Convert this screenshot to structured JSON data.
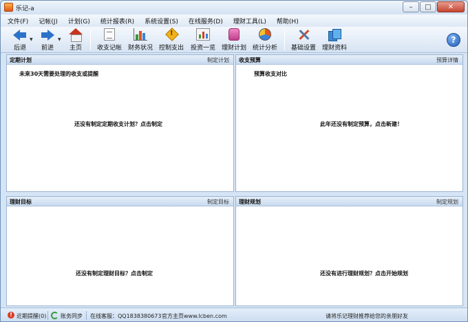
{
  "window": {
    "title": "乐记-a"
  },
  "menu": [
    "文件(F)",
    "记帐(J)",
    "计划(G)",
    "统计报表(R)",
    "系统设置(S)",
    "在线服务(D)",
    "理财工具(L)",
    "帮助(H)"
  ],
  "toolbar": {
    "back": "后退",
    "forward": "前进",
    "home": "主页",
    "income_expense": "收支记帐",
    "finance_status": "财务状况",
    "control_spending": "控制支出",
    "investment": "投资一览",
    "finance_plan": "理财计划",
    "stats": "统计分析",
    "basic_settings": "基础设置",
    "finance_data": "理财资料",
    "help_glyph": "?"
  },
  "panels": {
    "schedule": {
      "title": "定期计划",
      "link": "制定计划",
      "subtitle": "未来30天需要处理的收支或提醒",
      "message": "还没有制定定期收支计划？点击制定"
    },
    "budget": {
      "title": "收支预算",
      "link": "预算详情",
      "subtitle": "预算收支对比",
      "message": "此年还没有制定预算，点击新建！"
    },
    "goal": {
      "title": "理财目标",
      "link": "制定目标",
      "message": "还没有制定理财目标？点击制定"
    },
    "planning": {
      "title": "理财规划",
      "link": "制定规划",
      "message": "还没有进行理财规划？点击开始规划"
    }
  },
  "status": {
    "reminders": "近期提醒(0)",
    "sync": "账务同步",
    "support": "在线客服：QQ1838380673",
    "homepage": "官方主页www.lcben.com",
    "recommend": "请将乐记理财推荐给您的亲朋好友"
  },
  "colors": {
    "window_bg": "#d6e5f5",
    "panel_header": "#c9dbef",
    "close_button": "#c6452f",
    "accent_blue": "#2d72c9"
  }
}
